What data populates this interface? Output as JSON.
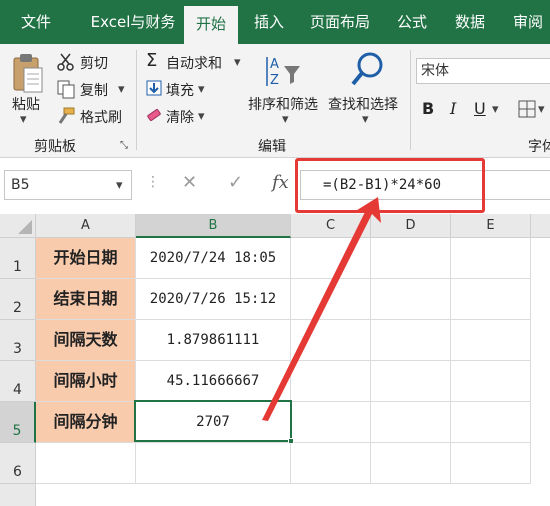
{
  "ribbon_tabs": {
    "file": "文件",
    "excel_finance": "Excel与财务",
    "home": "开始",
    "insert": "插入",
    "page_layout": "页面布局",
    "formulas": "公式",
    "data": "数据",
    "review": "审阅"
  },
  "clipboard": {
    "paste": "粘贴",
    "cut": "剪切",
    "copy": "复制",
    "format_painter": "格式刷",
    "group_label": "剪贴板"
  },
  "editing": {
    "autosum": "自动求和",
    "fill": "填充",
    "clear": "清除",
    "sort_filter": "排序和筛选",
    "find_select": "查找和选择",
    "group_label": "编辑"
  },
  "font": {
    "name": "宋体",
    "bold": "B",
    "italic": "I",
    "underline": "U",
    "group_label_partial": "字体"
  },
  "formula_bar": {
    "name_box": "B5",
    "fx": "fx",
    "formula": "=(B2-B1)*24*60"
  },
  "columns": [
    "A",
    "B",
    "C",
    "D",
    "E"
  ],
  "rows": [
    "1",
    "2",
    "3",
    "4",
    "5",
    "6"
  ],
  "cells": {
    "A1": "开始日期",
    "B1": "2020/7/24 18:05",
    "A2": "结束日期",
    "B2": "2020/7/26 15:12",
    "A3": "间隔天数",
    "B3": "1.879861111",
    "A4": "间隔小时",
    "B4": "45.11666667",
    "A5": "间隔分钟",
    "B5": "2707"
  },
  "colors": {
    "excel_green": "#217346",
    "label_fill": "#f8cbad",
    "annotation_red": "#e53935"
  }
}
